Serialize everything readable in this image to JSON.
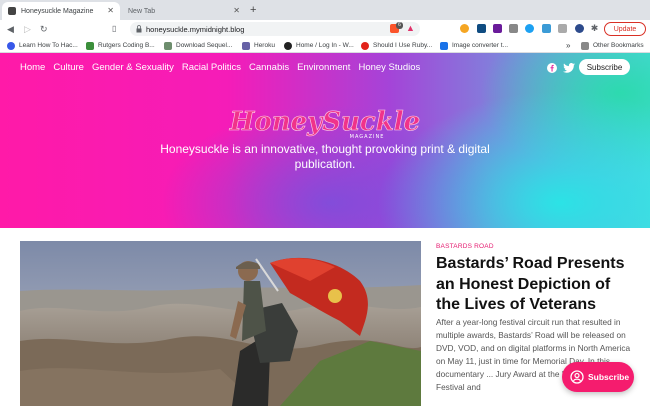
{
  "browser": {
    "tabs": [
      {
        "label": "Honeysuckle Magazine",
        "active": true
      },
      {
        "label": "New Tab",
        "active": false
      }
    ],
    "url": "honeysuckle.mymidnight.blog",
    "update_label": "Update",
    "extension_badges": {
      "brave": "6"
    },
    "bookmarks": [
      {
        "label": "Learn How To Hac...",
        "icon": "wordpress-icon",
        "color": "#3858e9"
      },
      {
        "label": "Rutgers Coding B...",
        "icon": "folder-icon",
        "color": "#3b8f3b"
      },
      {
        "label": "Download Sequel...",
        "icon": "folder-icon",
        "color": "#6d8d6d"
      },
      {
        "label": "Heroku",
        "icon": "heroku-icon",
        "color": "#6762a6"
      },
      {
        "label": "Home / Log In - W...",
        "icon": "wordpress-icon",
        "color": "#222222"
      },
      {
        "label": "Should I Use Ruby...",
        "icon": "stop-icon",
        "color": "#e2231a"
      },
      {
        "label": "Image converter t...",
        "icon": "image-icon",
        "color": "#1a73e8"
      }
    ],
    "other_bookmarks": "Other Bookmarks"
  },
  "site": {
    "nav": [
      "Home",
      "Culture",
      "Gender & Sexuality",
      "Racial Politics",
      "Cannabis",
      "Environment",
      "Honey Studios"
    ],
    "subscribe_top": "Subscribe",
    "logo_text": "HoneySuckle",
    "logo_sub": "MAGAZINE",
    "tagline": "Honeysuckle is an innovative, thought provoking print & digital publication.",
    "article": {
      "category": "BASTARDS ROAD",
      "title": "Bastards’ Road Presents an Honest Depiction of the Lives of Veterans",
      "excerpt": "After a year-long festival circuit run that resulted in multiple awards, Bastards’ Road will be released on DVD, VOD, and on digital platforms in North America on May 11, just in time for Memorial Day. In this documentary ... Jury Award at the Naples Internat... Festival and"
    },
    "subscribe_float": "Subscribe",
    "colors": {
      "accent": "#f51c6e",
      "brand_pink": "#ff1aa8",
      "brand_cyan": "#4fd6e0"
    }
  }
}
